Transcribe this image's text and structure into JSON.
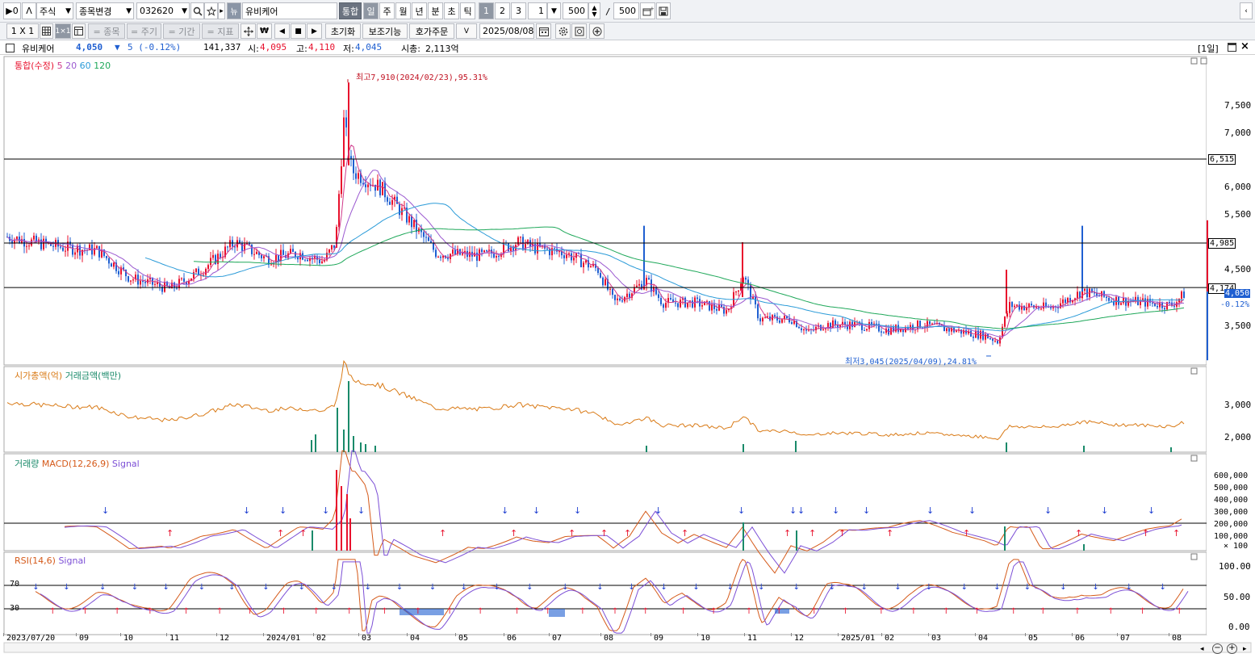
{
  "toolbar": {
    "panel_toggle_label": "▶0",
    "up_label": "ᐱ",
    "market": "주식",
    "change_label": "종목변경",
    "code": "032620",
    "new_badge": "뉴",
    "stock_name": "유비케어",
    "combined_label": "통합",
    "periods": [
      "일",
      "주",
      "월",
      "년",
      "분",
      "초",
      "틱"
    ],
    "nums": [
      "1",
      "2",
      "3"
    ],
    "interval_value": "1",
    "count_value": "500",
    "slash": "/",
    "total_value": "500"
  },
  "toolbar2": {
    "layout1": "1 X 1",
    "layout2": "1×1",
    "eq_stock": "= 종목",
    "eq_period": "= 주기",
    "eq_range": "= 기간",
    "eq_indicator": "= 지표",
    "reset": "초기화",
    "aux": "보조기능",
    "order": "호가주문",
    "date": "2025/08/08"
  },
  "info": {
    "name": "유비케어",
    "price": "4,050",
    "arrow": "▼",
    "change": "5 (-0.12%)",
    "volume": "141,337",
    "open_label": "시:",
    "open": "4,095",
    "high_label": "고:",
    "high": "4,110",
    "low_label": "저:",
    "low": "4,045",
    "cap_label": "시총:",
    "cap": "2,113억",
    "period_tag": "[1일]"
  },
  "price_panel": {
    "legend_main": "통합(수정)",
    "legend_ma": [
      "5",
      "20",
      "60",
      "120"
    ],
    "max_note": "최고7,910(2024/02/23),95.31%",
    "min_note": "최저3,045(2025/04/09),24.81%",
    "y_ticks": [
      "7,500",
      "7,000",
      "6,500",
      "6,000",
      "5,500",
      "5,000",
      "4,500",
      "4,000",
      "3,500"
    ],
    "lines": [
      "6,515",
      "4,985",
      "4,174"
    ],
    "last_price": "4,050",
    "last_change": "-0.12%"
  },
  "cap_panel": {
    "legend": [
      "시가총액(억)",
      "거래금액(백만)"
    ],
    "y_ticks": [
      "3,000",
      "2,000"
    ]
  },
  "macd_panel": {
    "legend": [
      "거래량",
      "MACD(12,26,9)",
      "Signal"
    ],
    "y_ticks": [
      "600,000",
      "500,000",
      "400,000",
      "300,000",
      "200,000",
      "100,000"
    ],
    "unit": "× 100"
  },
  "rsi_panel": {
    "legend": [
      "RSI(14,6)",
      "Signal"
    ],
    "levels": [
      "70",
      "30"
    ],
    "y_ticks": [
      "100.00",
      "50.00",
      "0.00"
    ]
  },
  "x_axis": [
    "2023/07/20",
    "09",
    "10",
    "11",
    "12",
    "2024/01",
    "02",
    "03",
    "04",
    "05",
    "06",
    "07",
    "08",
    "09",
    "10",
    "11",
    "12",
    "2025/01",
    "02",
    "03",
    "04",
    "05",
    "06",
    "07",
    "08"
  ],
  "colors": {
    "up": "#e8112d",
    "down": "#1f5fd1",
    "ma5": "#d0398a",
    "ma20": "#9b59d0",
    "ma60": "#2b9bd8",
    "ma120": "#1fa85a",
    "cap": "#d97a16",
    "trade": "#1a8a6a",
    "macd": "#d55a1a",
    "signal": "#7c4fd6",
    "rsi": "#d55a1a"
  }
}
